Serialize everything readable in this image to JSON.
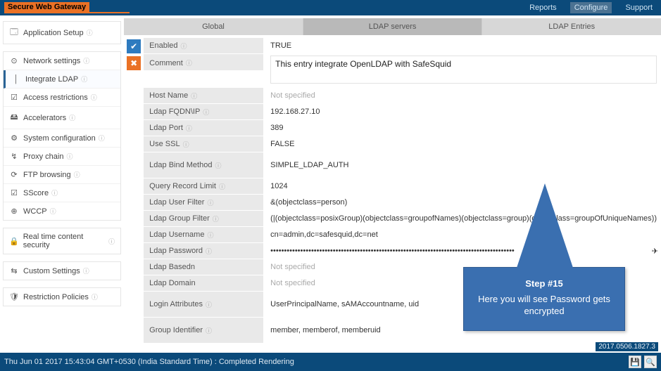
{
  "brand": "Secure Web Gateway",
  "topnav": {
    "reports": "Reports",
    "configure": "Configure",
    "support": "Support"
  },
  "sidebar": {
    "groups": [
      [
        {
          "icon": "🗔",
          "label": "Application Setup"
        }
      ],
      [
        {
          "icon": "⊙",
          "label": "Network settings"
        },
        {
          "icon": "│",
          "label": "Integrate LDAP",
          "active": true
        },
        {
          "icon": "☑",
          "label": "Access restrictions"
        },
        {
          "icon": "🖴",
          "label": "Accelerators"
        },
        {
          "icon": "⚙",
          "label": "System configuration"
        },
        {
          "icon": "↯",
          "label": "Proxy chain"
        },
        {
          "icon": "⟳",
          "label": "FTP browsing"
        },
        {
          "icon": "☑",
          "label": "SScore"
        },
        {
          "icon": "⊕",
          "label": "WCCP"
        }
      ],
      [
        {
          "icon": "🔒",
          "label": "Real time content security"
        }
      ],
      [
        {
          "icon": "⇆",
          "label": "Custom Settings"
        }
      ],
      [
        {
          "icon": "🛡",
          "label": "Restriction Policies"
        }
      ]
    ]
  },
  "tabs": {
    "global": "Global",
    "servers": "LDAP servers",
    "entries": "LDAP Entries"
  },
  "form": {
    "enabled": {
      "label": "Enabled",
      "value": "TRUE"
    },
    "comment": {
      "label": "Comment",
      "value": "This entry integrate OpenLDAP with SafeSquid"
    },
    "hostname": {
      "label": "Host Name",
      "value": "Not specified"
    },
    "fqdn": {
      "label": "Ldap FQDN\\IP",
      "value": "192.168.27.10"
    },
    "port": {
      "label": "Ldap Port",
      "value": "389"
    },
    "ssl": {
      "label": "Use SSL",
      "value": "FALSE"
    },
    "bind": {
      "label": "Ldap Bind Method",
      "value": "SIMPLE_LDAP_AUTH"
    },
    "qrl": {
      "label": "Query Record Limit",
      "value": "1024"
    },
    "userfilter": {
      "label": "Ldap User Filter",
      "value": "&(objectclass=person)"
    },
    "groupfilter": {
      "label": "Ldap Group Filter",
      "value": "(|(objectclass=posixGroup)(objectclass=groupofNames)(objectclass=group)(objectclass=groupOfUniqueNames))"
    },
    "username": {
      "label": "Ldap Username",
      "value": "cn=admin,dc=safesquid,dc=net"
    },
    "password": {
      "label": "Ldap Password",
      "value": "••••••••••••••••••••••••••••••••••••••••••••••••••••••••••••••••••••••••••••••••••••••••••"
    },
    "basedn": {
      "label": "Ldap Basedn",
      "value": "Not specified"
    },
    "domain": {
      "label": "Ldap Domain",
      "value": "Not specified"
    },
    "loginattrs": {
      "label": "Login Attributes",
      "value": "UserPrincipalName,  sAMAccountname,  uid"
    },
    "groupid": {
      "label": "Group Identifier",
      "value": "member,  memberof,  memberuid"
    }
  },
  "callout": {
    "step": "Step #15",
    "text": "Here you will see Password gets encrypted"
  },
  "footer": {
    "status": "Thu Jun 01 2017 15:43:04 GMT+0530 (India Standard Time) : Completed Rendering",
    "version": "2017.0506.1827.3"
  }
}
